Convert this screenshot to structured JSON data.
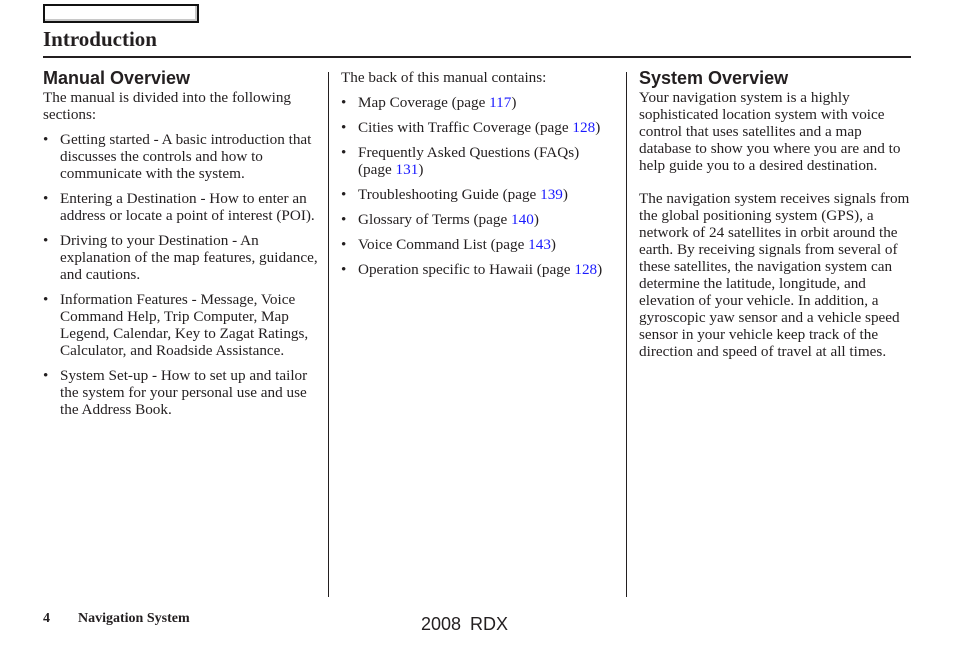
{
  "header": {
    "title": "Introduction"
  },
  "column1": {
    "heading": "Manual Overview",
    "intro": "The manual is divided into the following sections:",
    "items": [
      "Getting started - A basic introduction that discusses the controls and how to communicate with the system.",
      "Entering a Destination - How to enter an address or locate a point of interest (POI).",
      "Driving to your Destination - An explanation of the map features, guidance, and cautions.",
      "Information Features - Message, Voice Command Help, Trip Computer, Map Legend, Calendar, Key to Zagat Ratings, Calculator, and Roadside Assistance.",
      "System Set-up - How to set up and tailor the system for your personal use and use the Address Book."
    ]
  },
  "column2": {
    "intro": "The back of this manual contains:",
    "items": [
      {
        "label": "Map Coverage (page ",
        "page": "117",
        "close": ")"
      },
      {
        "label": "Cities with Traffic Coverage (page ",
        "page": "128",
        "close": ")"
      },
      {
        "label": "Frequently Asked Questions (FAQs) (page ",
        "page": "131",
        "close": ")"
      },
      {
        "label": "Troubleshooting Guide (page ",
        "page": "139",
        "close": ")"
      },
      {
        "label": "Glossary of Terms (page ",
        "page": "140",
        "close": ")"
      },
      {
        "label": "Voice Command List (page ",
        "page": "143",
        "close": ")"
      },
      {
        "label": "Operation specific to Hawaii (page ",
        "page": "128",
        "close": ")"
      }
    ]
  },
  "column3": {
    "heading": "System Overview",
    "paragraph1": "Your navigation system is a highly sophisticated location system with voice control that uses satellites and a map database to show you where you are and to help guide you to a desired destination.",
    "paragraph2": "The navigation system receives signals from the global positioning system (GPS), a network of 24 satellites in orbit around the earth. By receiving signals from several of these satellites, the navigation system can determine the latitude, longitude, and elevation of your vehicle. In addition, a gyroscopic yaw sensor and a vehicle speed sensor in your vehicle keep track of the direction and speed of travel at all times."
  },
  "footer": {
    "page_number": "4",
    "section": "Navigation System",
    "model": "2008  RDX"
  },
  "colors": {
    "link": "#1a1aff",
    "text": "#231f20"
  }
}
